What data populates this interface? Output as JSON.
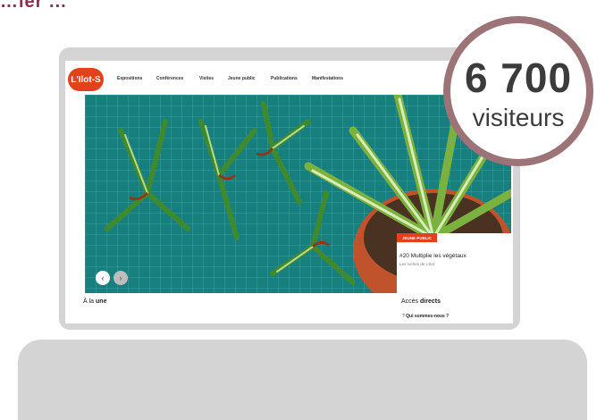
{
  "page": {
    "partial_heading": "…ier ...",
    "accent_color": "#8a2f4a"
  },
  "site": {
    "logo_text": "L'Ilot-S",
    "brand_color": "#e2421b",
    "nav": {
      "items": [
        "Expositions",
        "Conférences",
        "Visites",
        "Jeune public",
        "Publications",
        "Manifestations"
      ]
    },
    "hero": {
      "prev_icon": "chevron-left-icon",
      "next_icon": "chevron-right-icon",
      "card": {
        "badge": "JEUNE PUBLIC",
        "title": "#20 Multiplie les végétaux",
        "subtitle": "Les ruches de L'Ilot"
      }
    },
    "section_left": {
      "prefix": "À la",
      "bold": "une"
    },
    "section_right": {
      "prefix": "Accès",
      "bold": "directs"
    },
    "quick_link": {
      "icon": "question-icon",
      "label": "Qui sommes-nous ?"
    }
  },
  "stat": {
    "number": "6 700",
    "label": "visiteurs",
    "ring_color": "#9c7377"
  }
}
